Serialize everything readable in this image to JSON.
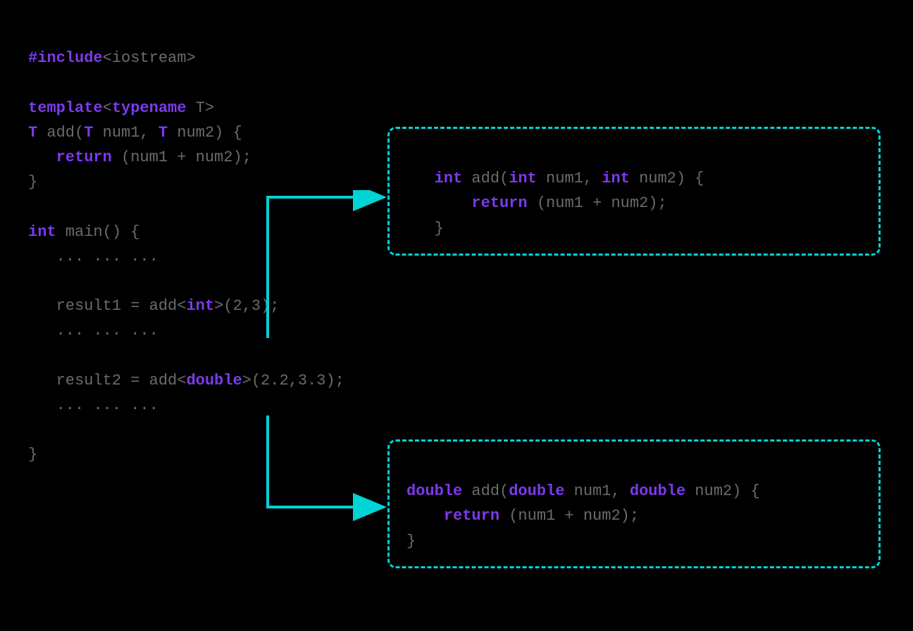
{
  "colors": {
    "background": "#000000",
    "keyword": "#8a5fd6",
    "keywordBold": "#7c3aed",
    "text": "#6b6b6b",
    "border": "#00d4d4",
    "arrow": "#00d4d4"
  },
  "mainCode": {
    "line1": {
      "include": "#include",
      "header": "<iostream>"
    },
    "line3": {
      "template": "template",
      "open": "<",
      "typename": "typename",
      "param": " T",
      "close": ">"
    },
    "line4": {
      "type": "T",
      "name": " add(",
      "t1": "T",
      "p1": " num1, ",
      "t2": "T",
      "p2": " num2) {"
    },
    "line5": {
      "ret": "return",
      "expr": " (num1 + num2);"
    },
    "line6": "}",
    "line8": {
      "int": "int",
      "main": " main() {"
    },
    "line9": "   ... ... ...",
    "line11": {
      "pre": "   result1 = add<",
      "type": "int",
      "post": ">(2,3);"
    },
    "line12": "   ... ... ...",
    "line14": {
      "pre": "   result2 = add<",
      "type": "double",
      "post": ">(2.2,3.3);"
    },
    "line15": "   ... ... ...",
    "line17": "}"
  },
  "intBox": {
    "line1": {
      "t1": "int",
      "name": " add(",
      "t2": "int",
      "p1": " num1, ",
      "t3": "int",
      "p2": " num2) {"
    },
    "line2": {
      "ret": "return",
      "expr": " (num1 + num2);"
    },
    "line3": "}"
  },
  "doubleBox": {
    "line1": {
      "t1": "double",
      "name": " add(",
      "t2": "double",
      "p1": " num1, ",
      "t3": "double",
      "p2": " num2) {"
    },
    "line2": {
      "ret": "return",
      "expr": " (num1 + num2);"
    },
    "line3": "}"
  }
}
